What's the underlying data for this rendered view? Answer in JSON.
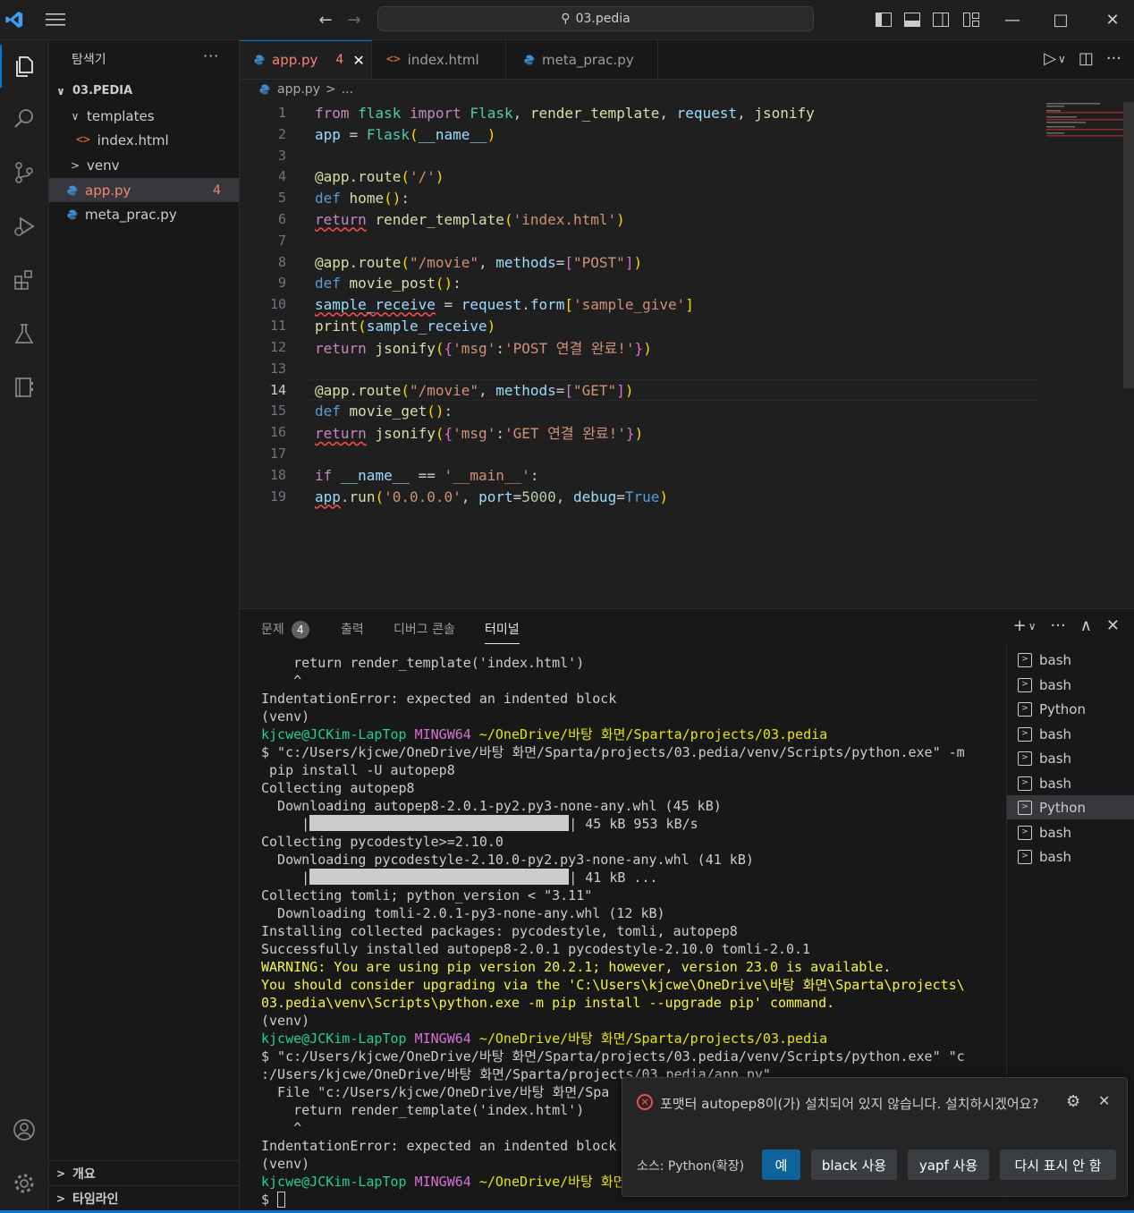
{
  "title_search": "03.pedia",
  "sidebar": {
    "title": "탐색기",
    "more": "···",
    "root": "03.PEDIA",
    "items": [
      {
        "label": "templates",
        "caret": "∨"
      },
      {
        "label": "index.html"
      },
      {
        "label": "venv",
        "caret": ">"
      },
      {
        "label": "app.py",
        "badge": "4"
      },
      {
        "label": "meta_prac.py"
      }
    ],
    "outline": "개요",
    "timeline": "타임라인"
  },
  "tabs": [
    {
      "label": "app.py",
      "count": "4"
    },
    {
      "label": "index.html"
    },
    {
      "label": "meta_prac.py"
    }
  ],
  "breadcrumb": {
    "file": "app.py",
    "sep": ">",
    "more": "..."
  },
  "code_lines": [
    "1",
    "2",
    "3",
    "4",
    "5",
    "6",
    "7",
    "8",
    "9",
    "10",
    "11",
    "12",
    "13",
    "14",
    "15",
    "16",
    "17",
    "18",
    "19"
  ],
  "panel": {
    "tabs": [
      "문제",
      "출력",
      "디버그 콘솔",
      "터미널"
    ],
    "problem_count": "4"
  },
  "terminal": {
    "lines": [
      "    return render_template('index.html')",
      "    ^",
      "IndentationError: expected an indented block",
      "(venv)",
      "$ \"c:/Users/kjcwe/OneDrive/바탕 화면/Sparta/projects/03.pedia/venv/Scripts/python.exe\" -m",
      " pip install -U autopep8",
      "Collecting autopep8",
      "  Downloading autopep8-2.0.1-py2.py3-none-any.whl (45 kB)",
      "Collecting pycodestyle>=2.10.0",
      "  Downloading pycodestyle-2.10.0-py2.py3-none-any.whl (41 kB)",
      "Collecting tomli; python_version < \"3.11\"",
      "  Downloading tomli-2.0.1-py3-none-any.whl (12 kB)",
      "Installing collected packages: pycodestyle, tomli, autopep8",
      "Successfully installed autopep8-2.0.1 pycodestyle-2.10.0 tomli-2.0.1",
      "WARNING: You are using pip version 20.2.1; however, version 23.0 is available.",
      "You should consider upgrading via the 'C:\\Users\\kjcwe\\OneDrive\\바탕 화면\\Sparta\\projects\\",
      "03.pedia\\venv\\Scripts\\python.exe -m pip install --upgrade pip' command.",
      "$ \"c:/Users/kjcwe/OneDrive/바탕 화면/Sparta/projects/03.pedia/venv/Scripts/python.exe\" \"c",
      ":/Users/kjcwe/OneDrive/바탕 화면/Sparta/projects/03.pedia/app.py\"",
      "  File \"c:/Users/kjcwe/OneDrive/바탕 화면/Spa"
    ],
    "prompt_user": "kjcwe@JCKim-LapTop",
    "prompt_env": "MINGW64",
    "prompt_path": "~/OneDrive/바탕 화면/Sparta/projects/03.pedia",
    "prompt_path_cut": "~/OneDrive/바탕 화면",
    "progress1": "| 45 kB 953 kB/s",
    "progress2": "| 41 kB ...",
    "progress_start": "     |"
  },
  "terminal_list": [
    "bash",
    "bash",
    "Python",
    "bash",
    "bash",
    "bash",
    "Python",
    "bash",
    "bash"
  ],
  "toast": {
    "message": "포맷터 autopep8이(가) 설치되어 있지 않습니다. 설치하시겠어요?",
    "source": "소스: Python(확장)",
    "buttons": [
      "예",
      "black 사용",
      "yapf 사용",
      "다시 표시 안 함"
    ]
  },
  "colors": {
    "accent": "#0078d4",
    "error": "#f14c4c",
    "prompt_green": "#23d18b",
    "prompt_magenta": "#d670d6",
    "warning": "#f5f543"
  }
}
